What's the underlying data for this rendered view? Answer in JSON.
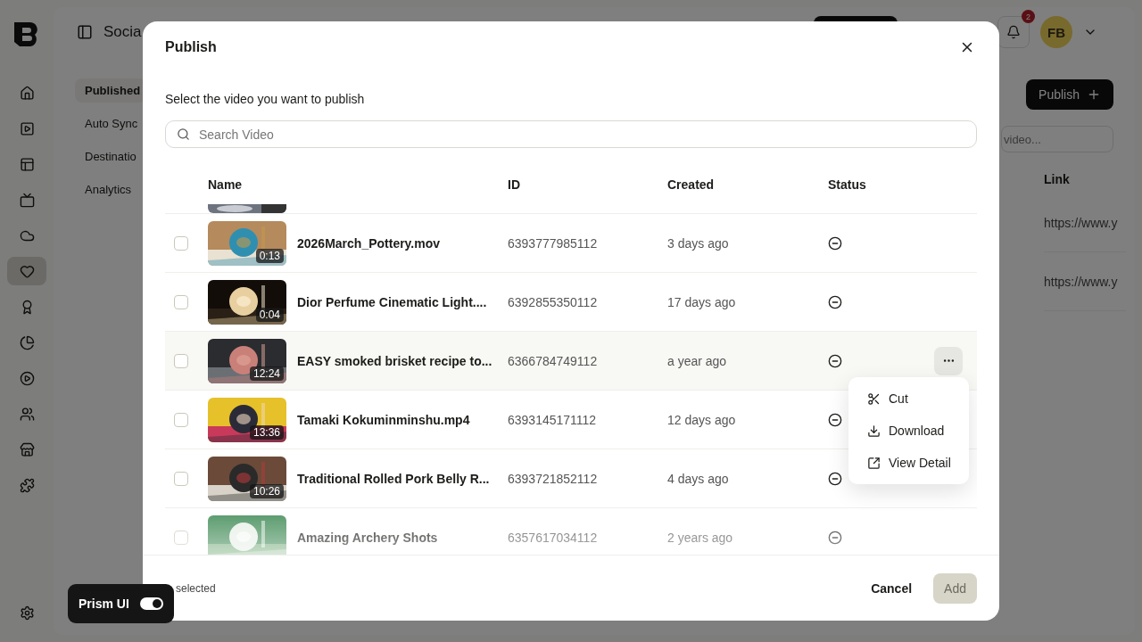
{
  "rail": [
    {
      "selected": false
    },
    {
      "selected": false
    },
    {
      "selected": false
    },
    {
      "selected": false
    },
    {
      "selected": false
    },
    {
      "selected": true
    },
    {
      "selected": false
    },
    {
      "selected": false
    },
    {
      "selected": false
    },
    {
      "selected": false
    },
    {
      "selected": false
    },
    {
      "selected": false
    }
  ],
  "header": {
    "title": "Socia",
    "notifications": "2",
    "avatar": "FB"
  },
  "subnav": [
    {
      "label": "Published",
      "selected": true
    },
    {
      "label": "Auto Sync",
      "selected": false
    },
    {
      "label": "Destinatio",
      "selected": false
    },
    {
      "label": "Analytics",
      "selected": false
    }
  ],
  "page": {
    "publish_button": "Publish",
    "search_placeholder": "video...",
    "link_header": "Link",
    "links": [
      "https://www.y",
      "https://www.y"
    ]
  },
  "modal": {
    "title": "Publish",
    "subtitle": "Select the video you want to publish",
    "search": {
      "placeholder": "Search Video"
    },
    "columns": [
      "Name",
      "ID",
      "Created",
      "Status"
    ],
    "rows": [
      {
        "name": "2026March_Pottery.mov",
        "duration": "0:13",
        "id": "6393777985112",
        "created": "3 days ago",
        "checked": false,
        "hovered": false
      },
      {
        "name": "Dior Perfume Cinematic Light....",
        "duration": "0:04",
        "id": "6392855350112",
        "created": "17 days ago",
        "checked": false,
        "hovered": false
      },
      {
        "name": "EASY smoked brisket recipe to...",
        "duration": "12:24",
        "id": "6366784749112",
        "created": "a year ago",
        "checked": false,
        "hovered": true
      },
      {
        "name": "Tamaki Kokuminminshu.mp4",
        "duration": "13:36",
        "id": "6393145171112",
        "created": "12 days ago",
        "checked": false,
        "hovered": false
      },
      {
        "name": "Traditional Rolled Pork Belly R...",
        "duration": "10:26",
        "id": "6393721852112",
        "created": "4 days ago",
        "checked": false,
        "hovered": false
      },
      {
        "name": "Amazing Archery Shots",
        "id": "6357617034112",
        "created": "2 years ago",
        "checked": false,
        "hovered": false
      }
    ],
    "row_menu": [
      {
        "kind": "cut",
        "label": "Cut"
      },
      {
        "kind": "download",
        "label": "Download"
      },
      {
        "kind": "open",
        "label": "View Detail"
      }
    ],
    "selected_count": "selected",
    "cancel": "Cancel",
    "add": {
      "label": "Add",
      "disabled": true
    }
  },
  "prism": {
    "label": "Prism UI",
    "on": true
  }
}
